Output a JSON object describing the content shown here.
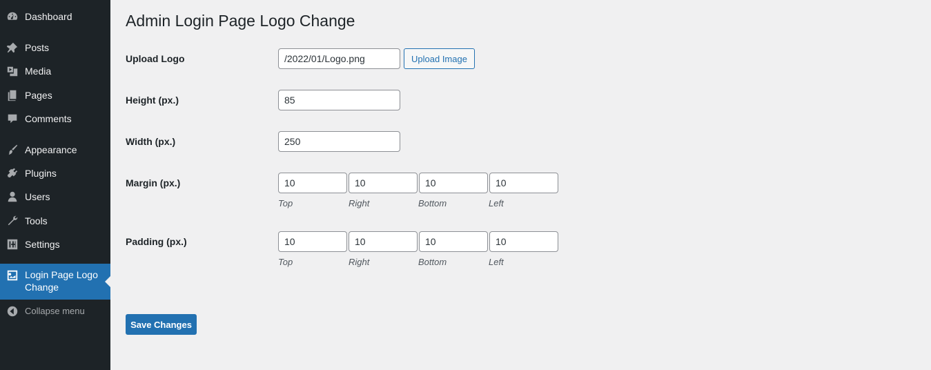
{
  "sidebar": {
    "items": [
      {
        "label": "Dashboard",
        "icon": "dashboard-icon"
      },
      {
        "label": "Posts",
        "icon": "pin-icon"
      },
      {
        "label": "Media",
        "icon": "media-icon"
      },
      {
        "label": "Pages",
        "icon": "pages-icon"
      },
      {
        "label": "Comments",
        "icon": "comment-icon"
      },
      {
        "label": "Appearance",
        "icon": "brush-icon"
      },
      {
        "label": "Plugins",
        "icon": "plug-icon"
      },
      {
        "label": "Users",
        "icon": "user-icon"
      },
      {
        "label": "Tools",
        "icon": "wrench-icon"
      },
      {
        "label": "Settings",
        "icon": "sliders-icon"
      },
      {
        "label": "Login Page Logo Change",
        "icon": "image-icon"
      }
    ],
    "collapse_label": "Collapse menu",
    "active_color": "#2271b1",
    "bg_color": "#1d2327"
  },
  "page": {
    "title": "Admin Login Page Logo Change"
  },
  "form": {
    "upload_logo_label": "Upload Logo",
    "upload_logo_value": "/2022/01/Logo.png",
    "upload_button_label": "Upload Image",
    "height_label": "Height (px.)",
    "height_value": "85",
    "width_label": "Width (px.)",
    "width_value": "250",
    "margin_label": "Margin (px.)",
    "margin": {
      "top": "10",
      "right": "10",
      "bottom": "10",
      "left": "10"
    },
    "padding_label": "Padding (px.)",
    "padding": {
      "top": "10",
      "right": "10",
      "bottom": "10",
      "left": "10"
    },
    "side_labels": {
      "top": "Top",
      "right": "Right",
      "bottom": "Bottom",
      "left": "Left"
    },
    "save_label": "Save Changes"
  }
}
